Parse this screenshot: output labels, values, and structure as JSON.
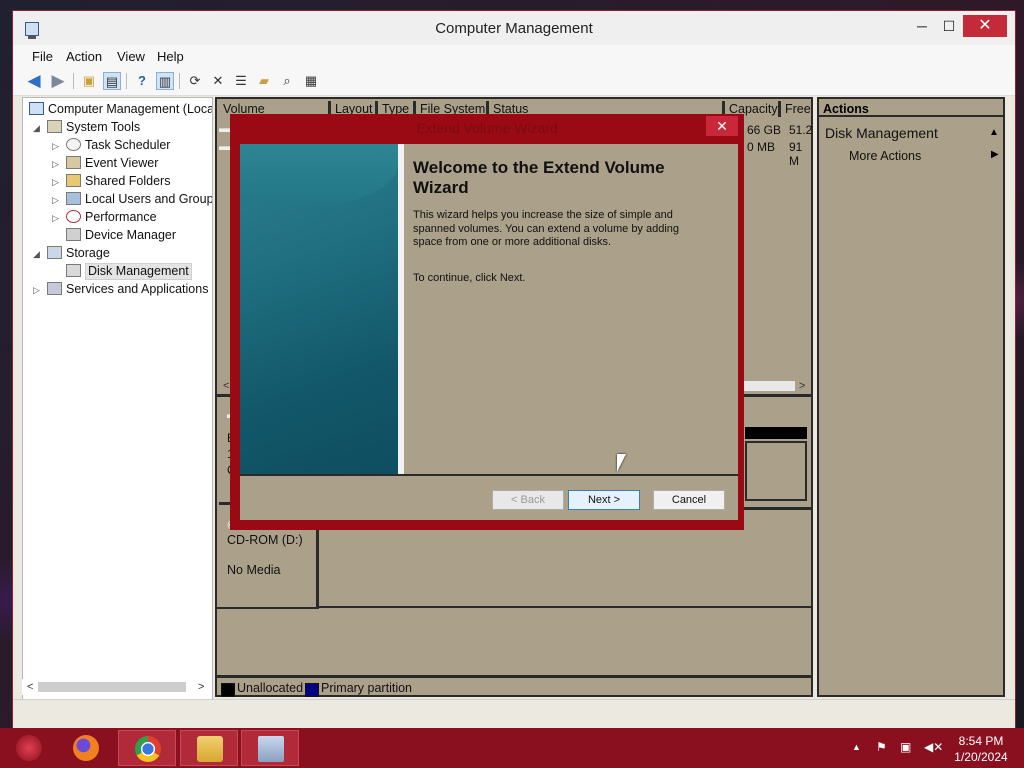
{
  "window": {
    "title": "Computer Management",
    "controls": {
      "minimize": "─",
      "maximize": "☐",
      "close": "✕"
    }
  },
  "menu": [
    "File",
    "Action",
    "View",
    "Help"
  ],
  "toolbar": {
    "icons": [
      "back-arrow-icon",
      "forward-arrow-icon",
      "up-folder-icon",
      "show-hide-tree-icon",
      "help-icon",
      "show-hide-action-pane-icon",
      "refresh-icon",
      "delete-icon",
      "properties-icon",
      "open-icon",
      "search-icon",
      "settings-icon"
    ]
  },
  "tree": {
    "items": [
      {
        "label": "Computer Management (Local",
        "expander": "",
        "level": 0
      },
      {
        "label": "System Tools",
        "expander": "◢",
        "level": 1
      },
      {
        "label": "Task Scheduler",
        "expander": "▷",
        "level": 2
      },
      {
        "label": "Event Viewer",
        "expander": "▷",
        "level": 2
      },
      {
        "label": "Shared Folders",
        "expander": "▷",
        "level": 2
      },
      {
        "label": "Local Users and Groups",
        "expander": "▷",
        "level": 2
      },
      {
        "label": "Performance",
        "expander": "▷",
        "level": 2
      },
      {
        "label": "Device Manager",
        "expander": "",
        "level": 2
      },
      {
        "label": "Storage",
        "expander": "◢",
        "level": 1
      },
      {
        "label": "Disk Management",
        "expander": "",
        "level": 2,
        "selected": true
      },
      {
        "label": "Services and Applications",
        "expander": "▷",
        "level": 1
      }
    ]
  },
  "volume_list": {
    "columns": [
      "Volume",
      "Layout",
      "Type",
      "File System",
      "Status",
      "Capacity",
      "Free"
    ],
    "visible_fragments": {
      "capacity_row1": "66 GB",
      "free_row1": "51.2",
      "capacity_row2": "0 MB",
      "free_row2": "91 M"
    }
  },
  "disks": {
    "disk0_fragments": [
      "B",
      "1",
      "C"
    ],
    "cdrom_label": "CD-ROM (D:)",
    "cdrom_status": "No Media"
  },
  "legend": {
    "unallocated": "Unallocated",
    "primary": "Primary partition",
    "unallocated_color": "#000000",
    "primary_color": "#000080"
  },
  "actions": {
    "header": "Actions",
    "section": "Disk Management",
    "more": "More Actions"
  },
  "wizard": {
    "title": "Extend Volume Wizard",
    "heading": "Welcome to the Extend Volume Wizard",
    "description": "This wizard helps you increase the size of simple and spanned volumes. You can extend a volume  by adding space from one or more additional disks.",
    "continue_text": "To continue, click Next.",
    "back_label": "< Back",
    "next_label": "Next >",
    "cancel_label": "Cancel"
  },
  "taskbar": {
    "apps": [
      "start-icon",
      "firefox-icon",
      "chrome-icon",
      "file-explorer-icon",
      "computer-management-icon"
    ],
    "clock_time": "8:54 PM",
    "clock_date": "1/20/2024"
  },
  "colors": {
    "accent": "#9a0a14",
    "taskbar": "#8a1020",
    "panel": "#aba08a"
  }
}
